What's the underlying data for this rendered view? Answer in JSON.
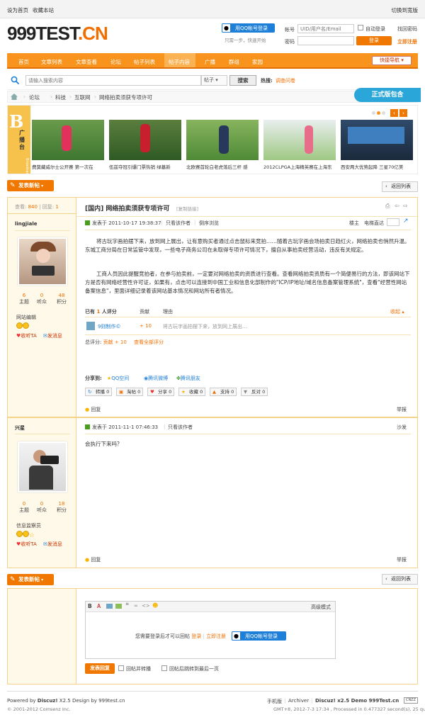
{
  "topbar": {
    "set_home": "设为首页",
    "bookmark": "收藏本站",
    "switch_style": "切换到宽版"
  },
  "logo": {
    "main": "999TEST",
    "suffix": ".CN"
  },
  "login": {
    "qq_button": "用QQ帐号登录",
    "qq_hint": "只需一步，快速开始",
    "account_label": "帐号",
    "account_placeholder": "UID/用户名/Email",
    "auto_login": "自动登录",
    "forgot": "找回密码",
    "password_label": "密码",
    "login_button": "登录",
    "register": "立即注册"
  },
  "nav": {
    "items": [
      "首页",
      "文章列表",
      "文章查看",
      "论坛",
      "帖子列表",
      "帖子内容",
      "广播",
      "群组",
      "家园"
    ],
    "active_index": 5,
    "quick_nav": "快捷导航"
  },
  "search": {
    "placeholder": "请输入搜索内容",
    "scope": "帖子",
    "button": "搜索",
    "hot_label": "热搜:",
    "hot_item": "调查问卷"
  },
  "breadcrumb": {
    "items": [
      "论坛",
      "科技",
      "互联网",
      "网络拍卖须获专项许可"
    ]
  },
  "edition_tag": "正式版包含",
  "banner": {
    "side_title": "广播台",
    "side_sub": "Broadcaster",
    "captions": [
      "费莫藏威尔士公开赛 第一次在",
      "伍兹夺冠引爆门票热销 绿墓新",
      "北欧赛首轮白老虎落后三杆 感",
      "2012CLPGA上海精英赛在上海东",
      "西安两大优势起降 三星70亿美"
    ]
  },
  "actions": {
    "new_post": "发表新帖",
    "back_list": "返回列表"
  },
  "thread": {
    "views_label": "查看:",
    "views": "840",
    "replies_label": "回复:",
    "replies": "1",
    "title": "[国内] 网络拍卖须获专项许可",
    "copy_link": "[复制链接]",
    "first_post": {
      "author": "lingjiale",
      "stats": [
        {
          "value": "6",
          "label": "主题"
        },
        {
          "value": "0",
          "label": "听众"
        },
        {
          "value": "48",
          "label": "积分"
        }
      ],
      "rank": "网站编辑",
      "follow": "收听TA",
      "message": "发消息",
      "posted": "发表于 2011-10-17 19:38:37",
      "only_author": "只看该作者",
      "reverse": "倒序浏览",
      "floor_label": "楼主",
      "elevator": "电梯直达",
      "para1": "将古玩字画拍摆下来，放到网上展出，让有意购买者通过点击鼠标来竞拍……随着古玩字画会场拍卖日趋红火，网络拍卖也悄然升温。东城工商分局在日常监管中发现，一些电子商务公司在未取得专项许可情况下，擅自从事拍卖经营活动，违反有关规定。",
      "para2": "工商人员因此提醒竞拍者，在参与拍卖前，一定要对网络拍卖的资质进行查看。查看网络拍卖资质有一个简便易行的方法，即该网站下方是否有网络经营性许可证，如果有，点击可以连接到中国工业和信息化部制作的\"ICP/IP地址/域名信息备案管理系统\"，查看\"经营性网站备案信息\"，里面详细记录着该网站基本情况和网站所有者情况。",
      "rate_count_prefix": "已有",
      "rate_count": "1",
      "rate_count_suffix": "人评分",
      "rate_col": "贡献",
      "reason_col": "理由",
      "collapse": "收起",
      "rate_user": "9则制作©",
      "rate_value": "+ 10",
      "rate_reason": "将古玩字画拍摆下来，放到网上展出...",
      "total_label": "总评分:",
      "total_item": "贡献 + 10",
      "view_all": "查看全部评分",
      "share_label": "分享到:",
      "share": [
        "QQ空间",
        "腾讯微博",
        "腾讯朋友"
      ],
      "buttons": [
        "转播 0",
        "淘帖 0",
        "分享 0",
        "收藏 0",
        "支持 0",
        "反对 0"
      ],
      "reply": "回复",
      "report": "举报"
    },
    "second_post": {
      "author": "兴星",
      "stats": [
        {
          "value": "0",
          "label": "主题"
        },
        {
          "value": "0",
          "label": "听众"
        },
        {
          "value": "18",
          "label": "积分"
        }
      ],
      "rank": "信息监察员",
      "follow": "收听TA",
      "message": "发消息",
      "posted": "发表于 2011-11-1 07:46:33",
      "only_author": "只看该作者",
      "floor_label": "沙发",
      "content": "会执行下来吗？",
      "reply": "回复",
      "report": "举报"
    }
  },
  "editor": {
    "advanced": "高级模式",
    "need_login": "您需要登录后才可以回帖",
    "login": "登录",
    "register": "立即注册",
    "qq_button": "用QQ帐号登录",
    "submit": "发表回复",
    "repost": "回帖并转播",
    "jump_last": "回帖后跳转到最后一页"
  },
  "footer": {
    "powered_prefix": "Powered by ",
    "powered_brand": "Discuz!",
    "powered_rest": " X2.5 Design by 999test.cn",
    "copyright": "© 2001-2012 Comsenz Inc.",
    "links": [
      "手机版",
      "Archiver",
      "Discuz! x2.5 Demo 999Test.cn"
    ],
    "cnzz": "CNZZ",
    "processed": "GMT+8, 2012-7-3 17:34 , Processed in 0.477327 second(s), 25 queries ."
  },
  "colors": {
    "accent": "#f8941d",
    "accent_dark": "#f07800",
    "link_blue": "#1e7fd9",
    "post_border": "#f3d28a"
  }
}
